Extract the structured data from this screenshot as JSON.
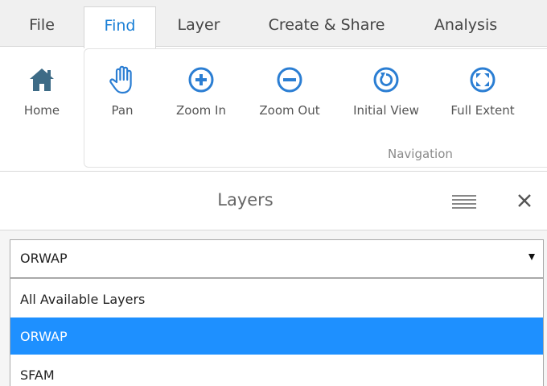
{
  "menu": {
    "tabs": [
      {
        "label": "File"
      },
      {
        "label": "Find"
      },
      {
        "label": "Layer"
      },
      {
        "label": "Create & Share"
      },
      {
        "label": "Analysis"
      }
    ],
    "active_tab": "Find"
  },
  "ribbon": {
    "home": {
      "label": "Home",
      "icon": "home-icon"
    },
    "navigation": {
      "group_label": "Navigation",
      "buttons": [
        {
          "label": "Pan",
          "icon": "hand-icon"
        },
        {
          "label": "Zoom In",
          "icon": "plus-circle-icon"
        },
        {
          "label": "Zoom Out",
          "icon": "minus-circle-icon"
        },
        {
          "label": "Initial View",
          "icon": "reset-icon"
        },
        {
          "label": "Full Extent",
          "icon": "expand-icon"
        }
      ]
    }
  },
  "layers_panel": {
    "title": "Layers",
    "menu_icon": "hamburger-icon",
    "close_icon": "close-icon",
    "select": {
      "value": "ORWAP",
      "options": [
        "All Available Layers",
        "ORWAP",
        "SFAM"
      ],
      "highlighted": "ORWAP"
    }
  },
  "colors": {
    "accent": "#1a7fd6",
    "icon": "#2b7ed3",
    "home_icon": "#3d6b86",
    "selected_option": "#1e90ff",
    "menubar_bg": "#f0f0f0"
  }
}
